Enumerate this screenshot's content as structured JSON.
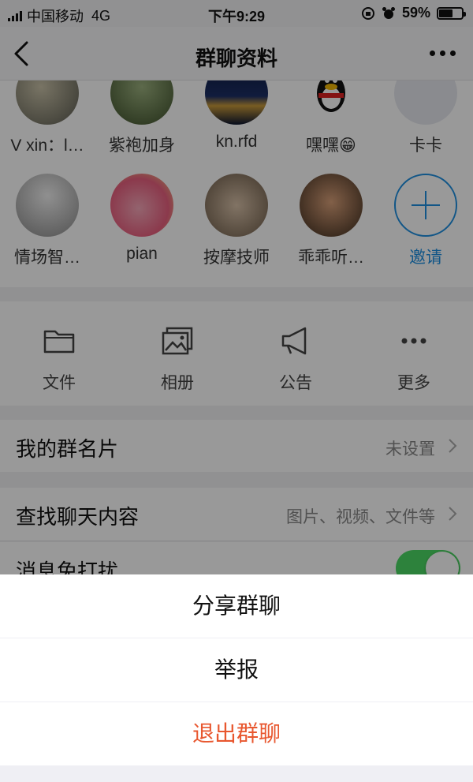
{
  "status_bar": {
    "carrier": "中国移动",
    "network": "4G",
    "time": "下午9:29",
    "battery": "59%",
    "battery_level": 0.59
  },
  "nav": {
    "title": "群聊资料"
  },
  "members": [
    {
      "name": "V xin：l…"
    },
    {
      "name": "紫袍加身"
    },
    {
      "name": "kn.rfd"
    },
    {
      "name": "嘿嘿😁"
    },
    {
      "name": "卡卡"
    },
    {
      "name": "情场智…"
    },
    {
      "name": "pian"
    },
    {
      "name": "按摩技师"
    },
    {
      "name": "乖乖听…"
    }
  ],
  "invite": {
    "label": "邀请"
  },
  "toolbar": [
    {
      "label": "文件",
      "icon": "folder-icon"
    },
    {
      "label": "相册",
      "icon": "photo-album-icon"
    },
    {
      "label": "公告",
      "icon": "megaphone-icon"
    },
    {
      "label": "更多",
      "icon": "more-icon"
    }
  ],
  "rows": {
    "group_card": {
      "label": "我的群名片",
      "value": "未设置"
    },
    "search_chat": {
      "label": "查找聊天内容",
      "value": "图片、视频、文件等"
    },
    "do_not_disturb": {
      "label": "消息免打扰",
      "enabled": true
    }
  },
  "action_sheet": {
    "share": "分享群聊",
    "report": "举报",
    "quit": "退出群聊"
  },
  "colors": {
    "accent": "#1e8fe1",
    "danger": "#e8572f",
    "toggle_on": "#4cd964"
  }
}
